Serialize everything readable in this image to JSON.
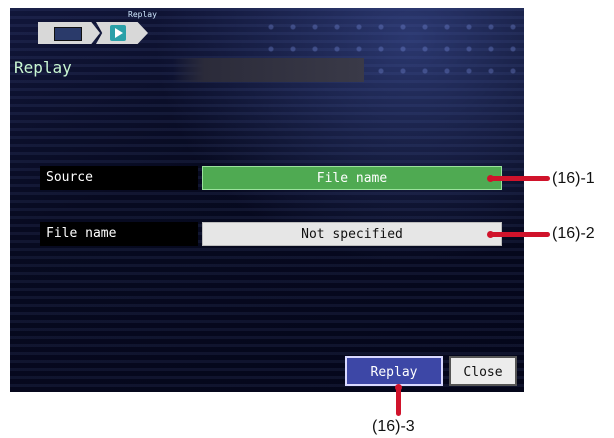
{
  "breadcrumb": {
    "current_label": "Replay",
    "icons": [
      "screen-icon",
      "play-icon"
    ]
  },
  "page_title": "Replay",
  "settings": {
    "source_label": "Source",
    "source_value": "File name",
    "filename_label": "File name",
    "filename_value": "Not specified"
  },
  "buttons": {
    "replay": "Replay",
    "close": "Close"
  },
  "callouts": {
    "c1": "(16)-1",
    "c2": "(16)-2",
    "c3": "(16)-3"
  },
  "colors": {
    "source_value_bg": "#4faa52",
    "replay_button_bg": "#3d47a6",
    "callout": "#d0132b"
  }
}
